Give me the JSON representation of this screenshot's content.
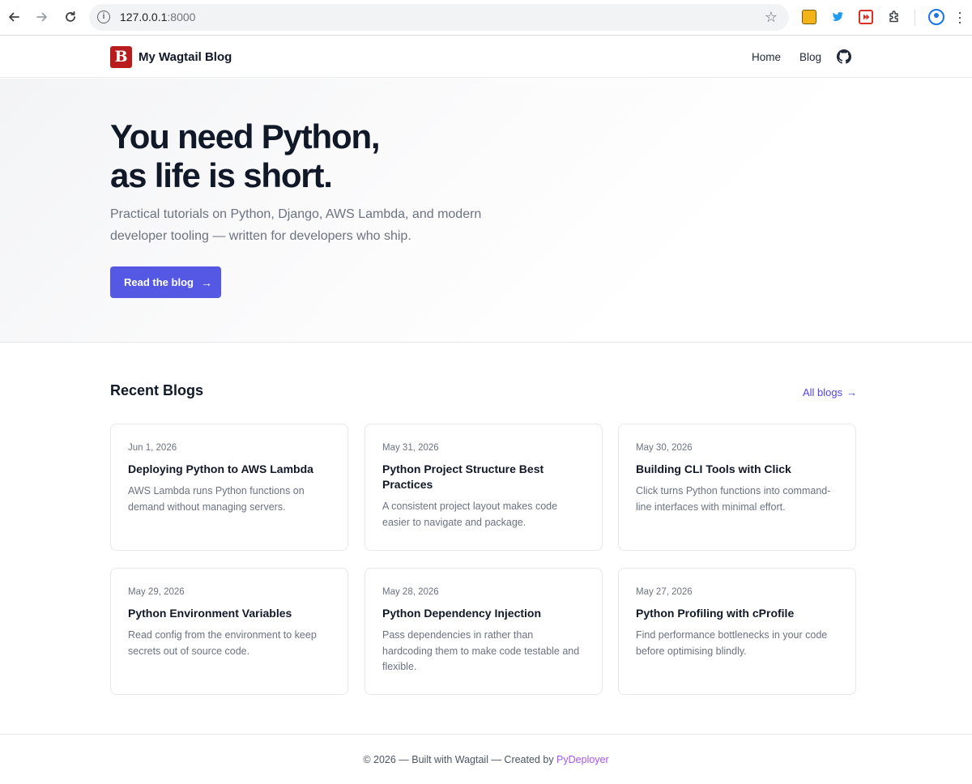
{
  "browser": {
    "url_host": "127.0.0.1",
    "url_port": ":8000"
  },
  "header": {
    "logo_letter": "B",
    "brand": "My Wagtail Blog",
    "nav": {
      "home": "Home",
      "blog": "Blog"
    }
  },
  "hero": {
    "title_line1": "You need Python,",
    "title_line2": "as life is short.",
    "subtitle": "Practical tutorials on Python, Django, AWS Lambda, and modern developer tooling — written for developers who ship.",
    "button_label": "Read the blog",
    "button_arrow": "→"
  },
  "recent": {
    "title": "Recent Blogs",
    "all_label": "All blogs",
    "all_arrow": "→",
    "posts": [
      {
        "date": "Jun 1, 2026",
        "title": "Deploying Python to AWS Lambda",
        "excerpt": "AWS Lambda runs Python functions on demand without managing servers."
      },
      {
        "date": "May 31, 2026",
        "title": "Python Project Structure Best Practices",
        "excerpt": "A consistent project layout makes code easier to navigate and package."
      },
      {
        "date": "May 30, 2026",
        "title": "Building CLI Tools with Click",
        "excerpt": "Click turns Python functions into command-line interfaces with minimal effort."
      },
      {
        "date": "May 29, 2026",
        "title": "Python Environment Variables",
        "excerpt": "Read config from the environment to keep secrets out of source code."
      },
      {
        "date": "May 28, 2026",
        "title": "Python Dependency Injection",
        "excerpt": "Pass dependencies in rather than hardcoding them to make code testable and flexible."
      },
      {
        "date": "May 27, 2026",
        "title": "Python Profiling with cProfile",
        "excerpt": "Find performance bottlenecks in your code before optimising blindly."
      }
    ]
  },
  "footer": {
    "text": "© 2026 — Built with Wagtail — Created by ",
    "link": "PyDeployer"
  },
  "colors": {
    "accent": "#5558e3",
    "link": "#4f46e5",
    "logo_bg": "#b91c1c",
    "footer_link": "#a855f7"
  }
}
